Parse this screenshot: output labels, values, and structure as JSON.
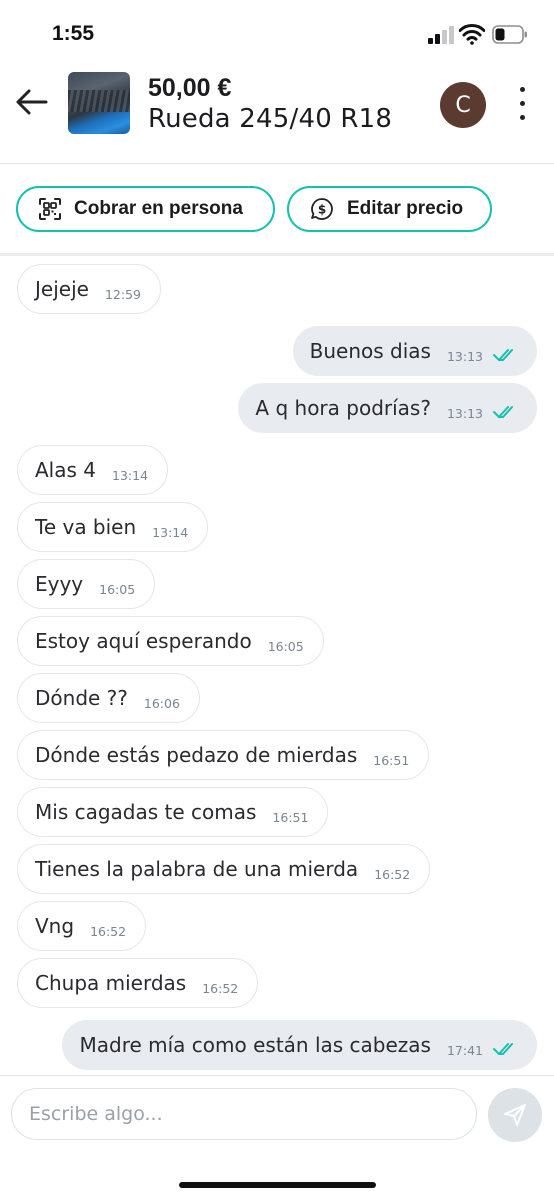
{
  "status_bar": {
    "time": "1:55"
  },
  "header": {
    "price": "50,00 €",
    "title": "Rueda 245/40 R18",
    "avatar_initial": "C"
  },
  "actions": {
    "cobrar_label": "Cobrar en persona",
    "editar_label": "Editar precio"
  },
  "colors": {
    "accent": "#13c1ac",
    "avatar_bg": "#5b3a30",
    "outgoing_bubble": "#e8ecf0"
  },
  "messages": [
    {
      "dir": "in",
      "text": "Jejeje",
      "time": "12:59"
    },
    {
      "dir": "out",
      "text": "Buenos dias",
      "time": "13:13",
      "read": true
    },
    {
      "dir": "out",
      "text": "A q hora podrías?",
      "time": "13:13",
      "read": true
    },
    {
      "dir": "in",
      "text": "Alas 4",
      "time": "13:14"
    },
    {
      "dir": "in",
      "text": "Te va bien",
      "time": "13:14"
    },
    {
      "dir": "in",
      "text": "Eyyy",
      "time": "16:05"
    },
    {
      "dir": "in",
      "text": "Estoy aquí esperando",
      "time": "16:05"
    },
    {
      "dir": "in",
      "text": "Dónde ??",
      "time": "16:06"
    },
    {
      "dir": "in",
      "text": "Dónde estás pedazo de mierdas",
      "time": "16:51"
    },
    {
      "dir": "in",
      "text": "Mis cagadas te comas",
      "time": "16:51"
    },
    {
      "dir": "in",
      "text": "Tienes la palabra de una mierda",
      "time": "16:52"
    },
    {
      "dir": "in",
      "text": "Vng",
      "time": "16:52"
    },
    {
      "dir": "in",
      "text": "Chupa mierdas",
      "time": "16:52"
    },
    {
      "dir": "out",
      "text": "Madre mía como están las cabezas",
      "time": "17:41",
      "read": true
    }
  ],
  "composer": {
    "placeholder": "Escribe algo..."
  }
}
